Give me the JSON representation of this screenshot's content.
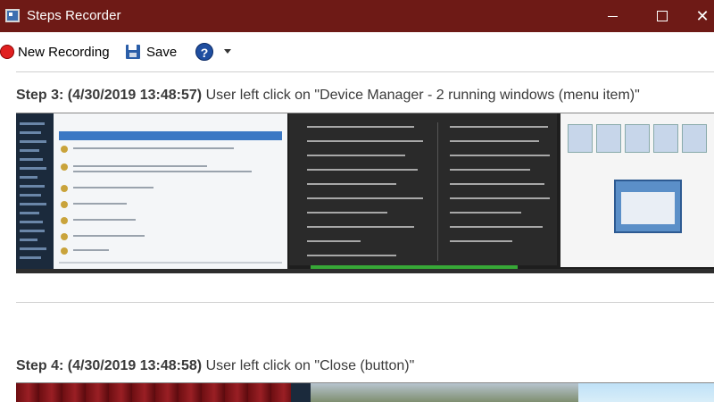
{
  "window": {
    "title": "Steps Recorder",
    "controls": {
      "minimize": "minimize",
      "maximize": "maximize",
      "close": "✕"
    }
  },
  "toolbar": {
    "new_recording_label": "New Recording",
    "save_label": "Save",
    "help_label": "?"
  },
  "steps": [
    {
      "id": "Step 3:",
      "timestamp": "(4/30/2019 13:48:57)",
      "description": "User left click on \"Device Manager - 2 running windows (menu item)\""
    },
    {
      "id": "Step 4:",
      "timestamp": "(4/30/2019 13:48:58)",
      "description": "User left click on \"Close (button)\""
    }
  ],
  "colors": {
    "titlebar": "#6e1a16",
    "record": "#e02020",
    "save_icon": "#2b5ea8",
    "help_icon": "#1f4ea0"
  }
}
